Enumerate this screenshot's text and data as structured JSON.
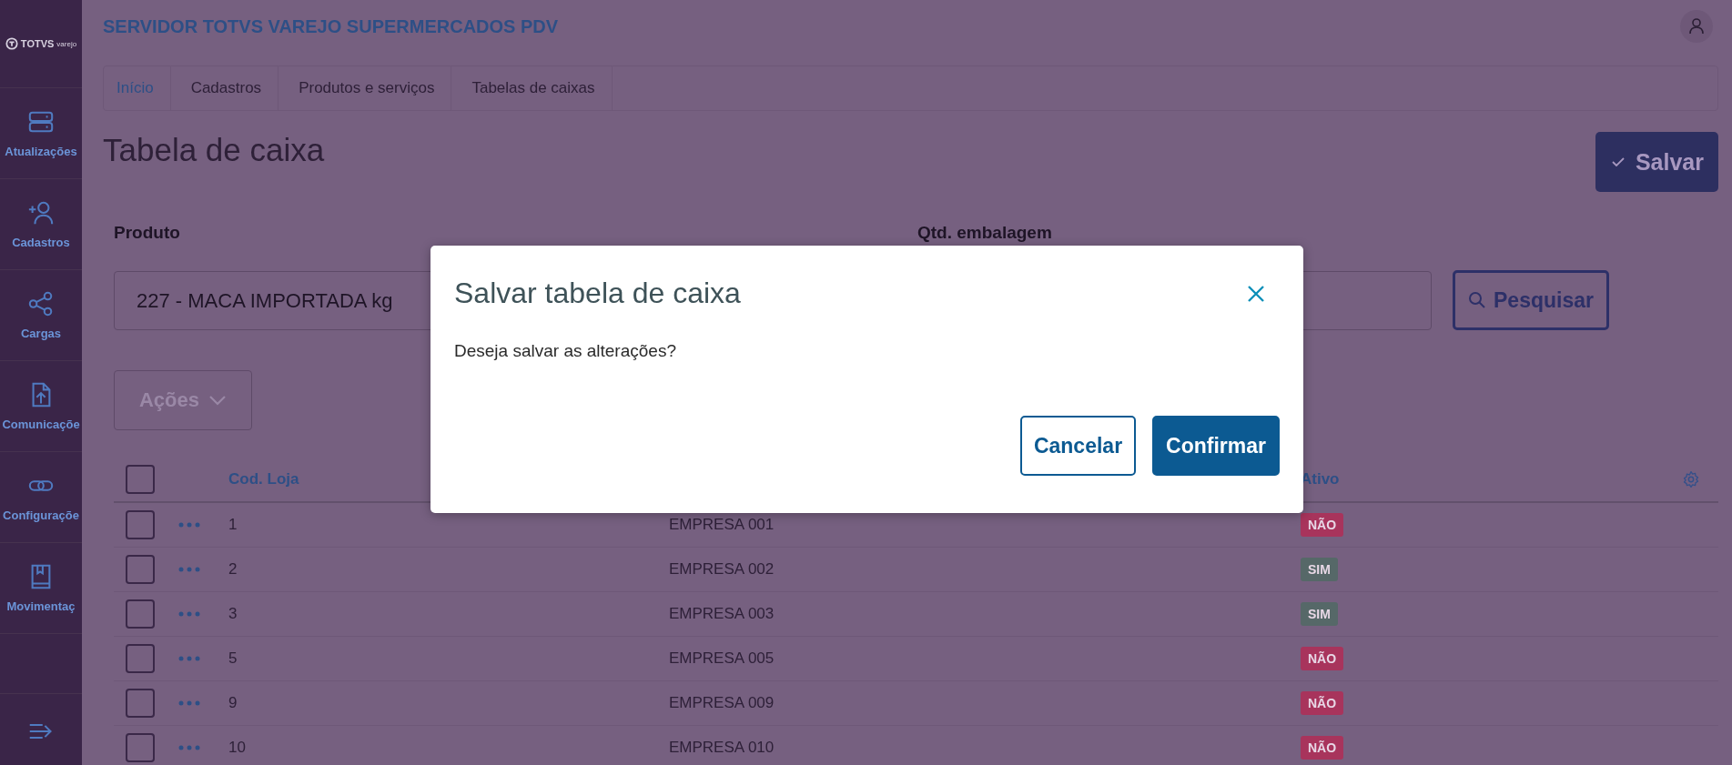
{
  "sidebar": {
    "logo": "TOTVS",
    "logo_sub": "varejo",
    "items": [
      {
        "label": "Atualizações"
      },
      {
        "label": "Cadastros"
      },
      {
        "label": "Cargas"
      },
      {
        "label": "Comunicaçõe"
      },
      {
        "label": "Configuraçõe"
      },
      {
        "label": "Movimentaç"
      }
    ]
  },
  "header": {
    "title": "SERVIDOR TOTVS VAREJO SUPERMERCADOS PDV"
  },
  "breadcrumbs": [
    {
      "label": "Início",
      "link": true
    },
    {
      "label": "Cadastros",
      "link": false
    },
    {
      "label": "Produtos e serviços",
      "link": false
    },
    {
      "label": "Tabelas de caixas",
      "link": false
    }
  ],
  "page_title": "Tabela de caixa",
  "save_button": "Salvar",
  "form": {
    "fields": [
      {
        "label": "Produto",
        "value": "227 - MACA IMPORTADA kg"
      },
      {
        "label": "Qtd. embalagem"
      }
    ],
    "search_button": "Pesquisar"
  },
  "actions_button": {
    "label": "Ações",
    "disabled": true
  },
  "table": {
    "select_all": false,
    "columns": [
      "Cod. Loja",
      "Ativo"
    ],
    "rows": [
      {
        "selected": false,
        "code": "1",
        "company": "EMPRESA 001",
        "badge": "NÃO",
        "color": "#a8345c"
      },
      {
        "selected": false,
        "code": "2",
        "company": "EMPRESA 002",
        "badge": "SIM",
        "color": "#566868"
      },
      {
        "selected": false,
        "code": "3",
        "company": "EMPRESA 003",
        "badge": "SIM",
        "color": "#566868"
      },
      {
        "selected": false,
        "code": "5",
        "company": "EMPRESA 005",
        "badge": "NÃO",
        "color": "#a8345c"
      },
      {
        "selected": false,
        "code": "9",
        "company": "EMPRESA 009",
        "badge": "NÃO",
        "color": "#a8345c"
      },
      {
        "selected": false,
        "code": "10",
        "company": "EMPRESA 010",
        "badge": "NÃO",
        "color": "#a8345c"
      }
    ]
  },
  "modal": {
    "title": "Salvar tabela de caixa",
    "message": "Deseja salvar as alterações?",
    "buttons": [
      {
        "label": "Cancelar",
        "kind": "secondary"
      },
      {
        "label": "Confirmar",
        "kind": "primary"
      }
    ]
  }
}
